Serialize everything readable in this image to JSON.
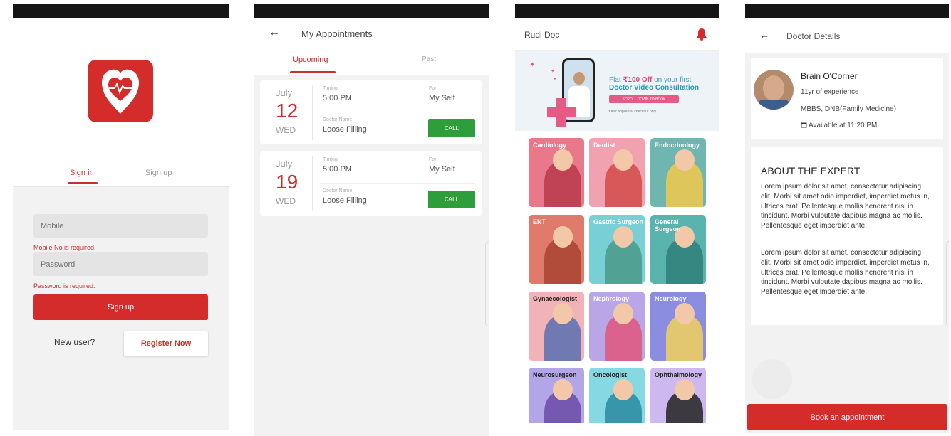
{
  "screens": {
    "signin": {
      "tabs": {
        "signin": "Sign in",
        "signup": "Sign up"
      },
      "mobile_placeholder": "Mobile",
      "mobile_error": "Mobile No is required.",
      "password_placeholder": "Password",
      "password_error": "Password is required.",
      "signup_button": "Sign up",
      "new_user": "New user?",
      "register_button": "Register Now"
    },
    "appointments": {
      "title": "My Appointments",
      "tabs": {
        "upcoming": "Upcoming",
        "past": "Past"
      },
      "items": [
        {
          "month": "July",
          "day": "12",
          "weekday": "WED",
          "timing_label": "Timing",
          "timing": "5:00 PM",
          "for_label": "For",
          "for": "My Self",
          "doctor_label": "Doctor Name",
          "doctor": "Loose Filling",
          "call": "CALL"
        },
        {
          "month": "July",
          "day": "19",
          "weekday": "WED",
          "timing_label": "Timing",
          "timing": "5:00 PM",
          "for_label": "For",
          "for": "My Self",
          "doctor_label": "Doctor Name",
          "doctor": "Loose Filling",
          "call": "CALL"
        }
      ]
    },
    "home": {
      "app_title": "Rudi Doc",
      "banner": {
        "line1_prefix": "Flat ",
        "line1_amount": "₹100 Off",
        "line1_suffix": " on your first",
        "line2": "Doctor Video Consultation",
        "button": "SCROLL DOWN TO BOOK",
        "note": "*Offer applied at checkout only"
      },
      "specialities": [
        {
          "name": "Cardiology",
          "bg": "#e8788a",
          "accent": "#b83a4b",
          "dark": false
        },
        {
          "name": "Dentist",
          "bg": "#f1a2b0",
          "accent": "#d44a4a",
          "dark": false
        },
        {
          "name": "Endocrinology",
          "bg": "#6fb6b0",
          "accent": "#f2c94c",
          "dark": false
        },
        {
          "name": "ENT",
          "bg": "#e07a6a",
          "accent": "#a84433",
          "dark": false
        },
        {
          "name": "Gastric Surgeon",
          "bg": "#78cfd6",
          "accent": "#4a9a8a",
          "dark": false
        },
        {
          "name": "General Surgeon",
          "bg": "#5ab4ae",
          "accent": "#2f7f7a",
          "dark": false
        },
        {
          "name": "Gynaecologist",
          "bg": "#f2b3b8",
          "accent": "#5b6fb0",
          "dark": true
        },
        {
          "name": "Nephrology",
          "bg": "#b9a6e6",
          "accent": "#e0567c",
          "dark": false
        },
        {
          "name": "Neurology",
          "bg": "#8b8ee0",
          "accent": "#f2d15c",
          "dark": false
        },
        {
          "name": "Neurosurgeon",
          "bg": "#b2a5e8",
          "accent": "#6a4aa6",
          "dark": true
        },
        {
          "name": "Oncologist",
          "bg": "#86d9e2",
          "accent": "#2a8aa0",
          "dark": true
        },
        {
          "name": "Ophthalmology",
          "bg": "#cdb8f0",
          "accent": "#222222",
          "dark": true
        }
      ]
    },
    "doctor": {
      "title": "Doctor Details",
      "name": "Brain O'Corner",
      "experience": "11yr of experience",
      "qualification": "MBBS, DNB(Family Medicine)",
      "availability": "Available at 11:20 PM",
      "about_heading": "ABOUT THE EXPERT",
      "paragraph1": "Lorem ipsum dolor sit amet, consectetur adipiscing elit. Morbi sit amet odio imperdiet, imperdiet metus in, ultrices erat. Pellentesque mollis hendrerit nisl in tincidunt. Morbi vulputate dapibus magna ac mollis. Pellentesque eget imperdiet ante.",
      "paragraph2": "Lorem ipsum dolor sit amet, consectetur adipiscing elit. Morbi sit amet odio imperdiet, imperdiet metus in, ultrices erat. Pellentesque mollis hendrerit nisl in tincidunt. Morbi vulputate dapibus magna ac mollis. Pellentesque eget imperdiet ante.",
      "book_button": "Book an appointment"
    }
  },
  "colors": {
    "brand_red": "#d42b2b",
    "call_green": "#2e9e3a",
    "banner_pink": "#e65a86"
  },
  "icons": [
    "heart-pulse-logo-icon",
    "back-arrow-icon",
    "bell-icon",
    "calendar-icon"
  ]
}
